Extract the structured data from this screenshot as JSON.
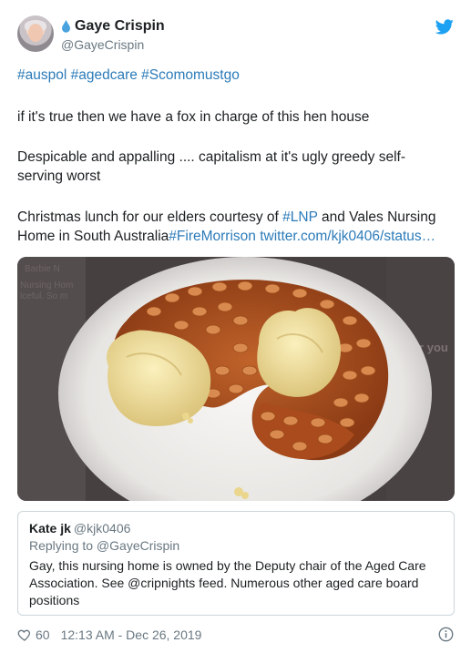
{
  "tweet": {
    "display_name": "Gaye Crispin",
    "handle": "@GayeCrispin",
    "hashtags": "#auspol #agedcare #Scomomustgo",
    "para1": "if it's true then we have a fox in charge of this hen house",
    "para2_line1": "Despicable and appalling .... capitalism at it's ugly greedy self-",
    "para2_line2": "serving worst",
    "para3_line1_pre": "Christmas lunch for our elders courtesy of ",
    "para3_line1_link": "#LNP",
    "para3_line1_post": " and Vales Nursing",
    "para3_line2_pre": "Home in South Australia",
    "para3_line2_hashtag": "#FireMorrison",
    "para3_line2_link": " twitter.com/kjk0406/status…"
  },
  "media": {
    "ghost_left_1": "Barbie N",
    "ghost_left_2": "Nursing Hom",
    "ghost_left_3": "lceful. So m",
    "ghost_right_1": "ds for you",
    "ghost_right_2": "ng",
    "ghost_right_3": "ng"
  },
  "quote": {
    "name": "Kate jk",
    "handle": "@kjk0406",
    "replying": "Replying to @GayeCrispin",
    "text": "Gay, this nursing home is owned by the Deputy chair of the Aged Care Association.  See @cripnights feed.  Numerous other aged care board positions"
  },
  "footer": {
    "likes": "60",
    "timestamp": "12:13 AM - Dec 26, 2019"
  },
  "colors": {
    "link": "#2b7bb9",
    "twitter_blue": "#1da1f2",
    "secondary_text": "#697882"
  }
}
